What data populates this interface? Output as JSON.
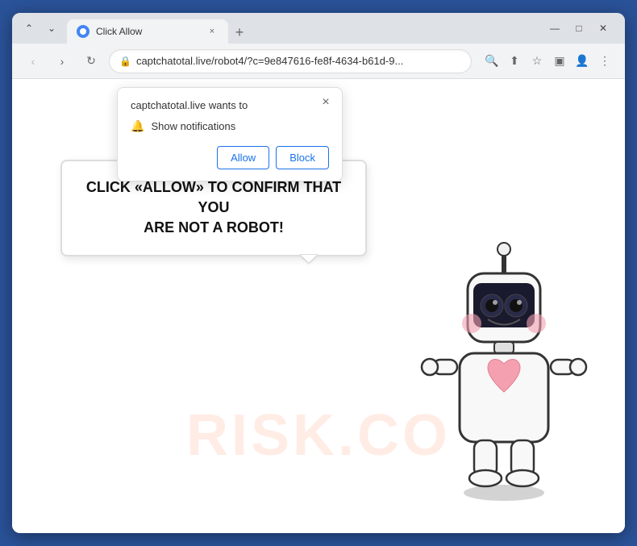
{
  "browser": {
    "tab": {
      "favicon_label": "favicon",
      "title": "Click Allow",
      "close_label": "×",
      "new_tab_label": "+"
    },
    "window_controls": {
      "minimize": "—",
      "maximize": "□",
      "close": "✕",
      "chevron_up": "⌃",
      "chevron_down": "⌄"
    },
    "nav": {
      "back_label": "‹",
      "forward_label": "›",
      "reload_label": "↻"
    },
    "url": {
      "lock_symbol": "🔒",
      "address": "captchatotal.live/robot4/?c=9e847616-fe8f-4634-b61d-9...",
      "search_icon": "🔍",
      "share_icon": "⬆",
      "bookmark_icon": "☆",
      "extension_icon": "▣",
      "account_icon": "👤",
      "menu_icon": "⋮"
    }
  },
  "notification_popup": {
    "title": "captchatotal.live wants to",
    "close_label": "×",
    "bell_label": "🔔",
    "notification_text": "Show notifications",
    "allow_label": "Allow",
    "block_label": "Block"
  },
  "page": {
    "bubble_text_line1": "CLICK «ALLOW» TO CONFIRM THAT YOU",
    "bubble_text_line2": "ARE NOT A ROBOT!",
    "watermark_text": "RISK.CO"
  }
}
